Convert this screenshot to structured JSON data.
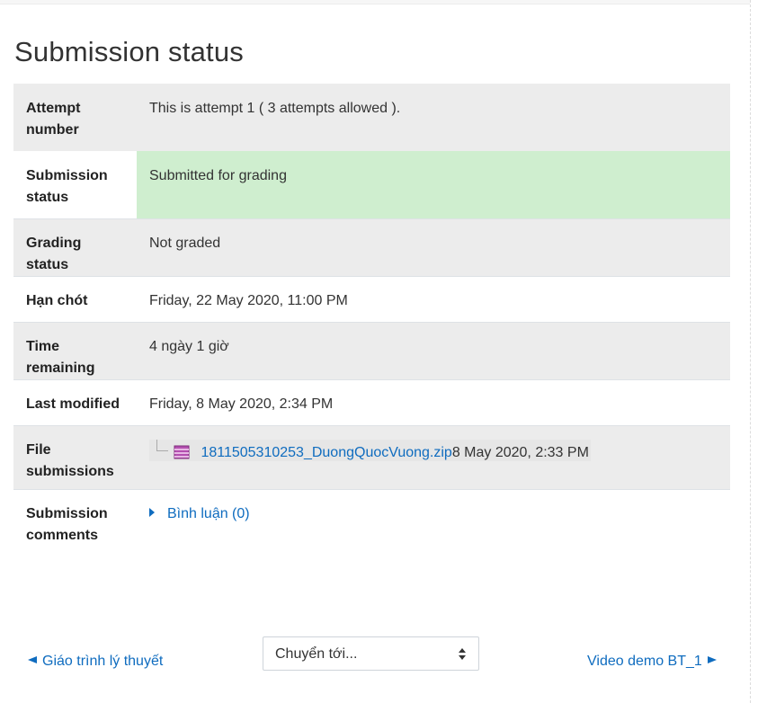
{
  "page": {
    "title": "Submission status"
  },
  "rows": {
    "attempt": {
      "label": "Attempt number",
      "value": "This is attempt 1 ( 3 attempts allowed )."
    },
    "submission": {
      "label": "Submission status",
      "value": "Submitted for grading",
      "highlight_color": "#cfeecf"
    },
    "grading": {
      "label": "Grading status",
      "value": "Not graded"
    },
    "deadline": {
      "label": "Hạn chót",
      "value": "Friday, 22 May 2020, 11:00 PM"
    },
    "remaining": {
      "label": "Time remaining",
      "value": "4 ngày 1 giờ"
    },
    "modified": {
      "label": "Last modified",
      "value": "Friday, 8 May 2020, 2:34 PM"
    },
    "files": {
      "label": "File submissions",
      "filename": "1811505310253_DuongQuocVuong.zip",
      "file_date": "8 May 2020, 2:33 PM",
      "icon": "zip-file-icon"
    },
    "comments": {
      "label": "Submission comments",
      "link": "Bình luận (0)"
    }
  },
  "nav": {
    "prev": "Giáo trình lý thuyết",
    "jump_to": "Chuyển tới...",
    "next": "Video demo BT_1"
  },
  "colors": {
    "link": "#0f6cbf",
    "row_shade": "#ececec"
  }
}
